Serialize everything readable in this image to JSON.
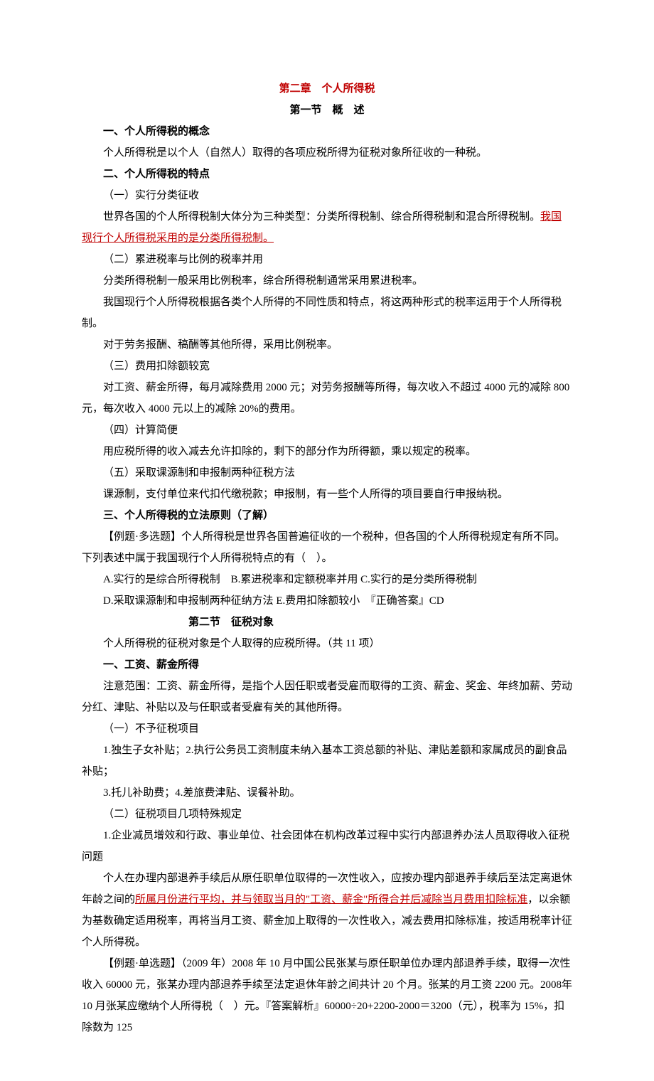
{
  "title_main": "第二章　个人所得税",
  "title_section1": "第一节　概　述",
  "h1": "一、个人所得税的概念",
  "p1": "个人所得税是以个人（自然人）取得的各项应税所得为征税对象所征收的一种税。",
  "h2": "二、个人所得税的特点",
  "p2": "（一）实行分类征收",
  "p3a": "世界各国的个人所得税制大体分为三种类型：分类所得税制、综合所得税制和混合所得税制。",
  "p3_red": "我国现行个人所得税采用的是分类所得税制。",
  "p4": "（二）累进税率与比例的税率并用",
  "p5": "分类所得税制一般采用比例税率，综合所得税制通常采用累进税率。",
  "p6": "我国现行个人所得税根据各类个人所得的不同性质和特点，将这两种形式的税率运用于个人所得税制。",
  "p7": "对于劳务报酬、稿酬等其他所得，采用比例税率。",
  "p8": "（三）费用扣除额较宽",
  "p9": "对工资、薪金所得，每月减除费用 2000 元；对劳务报酬等所得，每次收入不超过 4000 元的减除 800元，每次收入 4000 元以上的减除 20%的费用。",
  "p10": "（四）计算简便",
  "p11": "用应税所得的收入减去允许扣除的，剩下的部分作为所得额，乘以规定的税率。",
  "p12": "（五）采取课源制和申报制两种征税方法",
  "p13": "课源制，支付单位来代扣代缴税款；申报制，有一些个人所得的项目要自行申报纳税。",
  "h3": "三、个人所得税的立法原则（了解）",
  "p14": "【例题·多选题】个人所得税是世界各国普遍征收的一个税种，但各国的个人所得税规定有所不同。下列表述中属于我国现行个人所得税特点的有（　）。",
  "p15": "A.实行的是综合所得税制　B.累进税率和定额税率并用 C.实行的是分类所得税制",
  "p16": "D.采取课源制和申报制两种征纳方法 E.费用扣除额较小　『正确答案』CD",
  "title_section2": "第二节　征税对象",
  "p17": "个人所得税的征税对象是个人取得的应税所得。（共 11 项）",
  "h4": "一、工资、薪金所得",
  "p18": "注意范围：工资、薪金所得，是指个人因任职或者受雇而取得的工资、薪金、奖金、年终加薪、劳动分红、津贴、补贴以及与任职或者受雇有关的其他所得。",
  "p19": "（一）不予征税项目",
  "p20": "1.独生子女补贴；2.执行公务员工资制度未纳入基本工资总额的补贴、津贴差额和家属成员的副食品补贴；",
  "p21": "3.托儿补助费；4.差旅费津贴、误餐补助。",
  "p22": "（二）征税项目几项特殊规定",
  "p23": "1.企业减员增效和行政、事业单位、社会团体在机构改革过程中实行内部退养办法人员取得收入征税问题",
  "p24a": "个人在办理内部退养手续后从原任职单位取得的一次性收入，应按办理内部退养手续后至法定离退休年龄之间的",
  "p24_red": "所属月份进行平均，并与领取当月的\"工资、薪金\"所得合并后减除当月费用扣除标准",
  "p24b": "，以余额为基数确定适用税率，再将当月工资、薪金加上取得的一次性收入，减去费用扣除标准，按适用税率计征个人所得税。",
  "p25": "【例题·单选题】（2009 年）2008 年 10 月中国公民张某与原任职单位办理内部退养手续，取得一次性收入 60000 元，张某办理内部退养手续至法定退休年龄之间共计 20 个月。张某的月工资 2200 元。2008年 10 月张某应缴纳个人所得税（　）元。『答案解析』60000÷20+2200-2000＝3200（元），税率为 15%，扣除数为 125"
}
